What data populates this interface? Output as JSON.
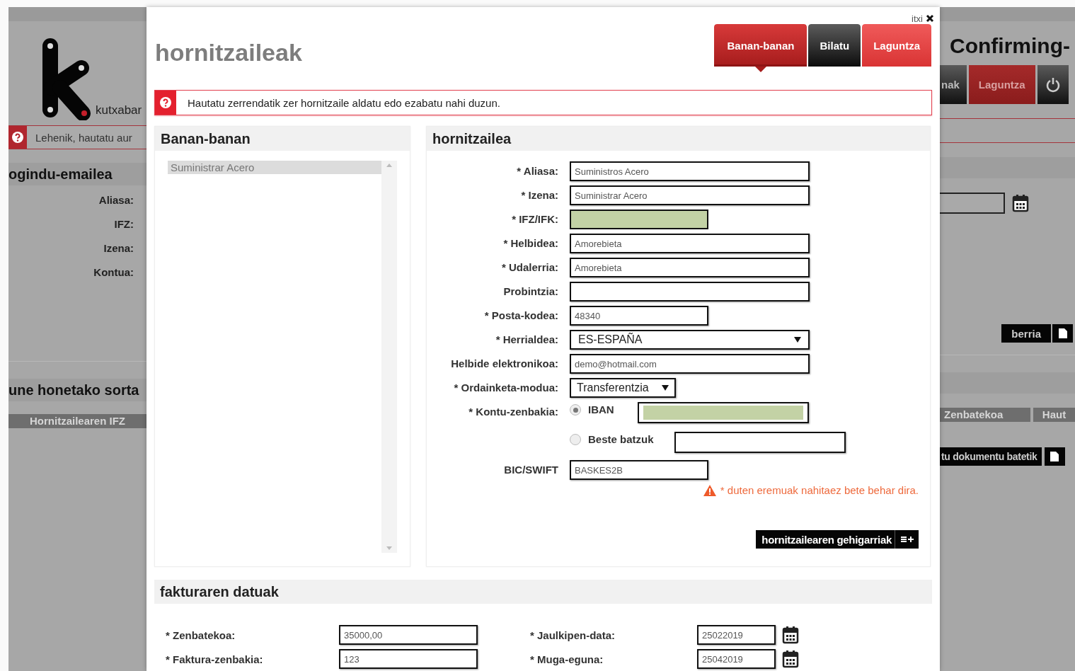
{
  "background_left": {
    "logo_text": "kutxabar",
    "notice": "Lehenik, hautatu aur",
    "section_title": "ogindu-emailea",
    "fields": [
      {
        "label": "Aliasa:"
      },
      {
        "label": "IFZ:"
      },
      {
        "label": "Izena:"
      },
      {
        "label": "Kontua:"
      }
    ],
    "batch_title": "une honetako sorta",
    "column": "Hornitzailearen IFZ"
  },
  "background_right": {
    "title": "Confirming-",
    "tabs": [
      {
        "label": "nak",
        "selected": false
      },
      {
        "label": "Laguntza",
        "selected": true
      }
    ],
    "new_button": "berria",
    "columns": [
      "Zenbatekoa",
      "Haut"
    ],
    "import_button": "tu dokumentu batetik"
  },
  "modal": {
    "close_label": "itxi",
    "title": "hornitzaileak",
    "tabs": [
      {
        "label": "Banan-banan",
        "selected": true,
        "kind": "nav"
      },
      {
        "label": "Bilatu",
        "selected": false,
        "kind": "nav"
      },
      {
        "label": "Laguntza",
        "selected": false,
        "kind": "help"
      }
    ],
    "message": "Hautatu zerrendatik zer hornitzaile aldatu edo ezabatu nahi duzun.",
    "list_panel": {
      "title": "Banan-banan",
      "items": [
        {
          "label": "Suministrar Acero",
          "selected": true
        }
      ]
    },
    "form": {
      "title": "hornitzailea",
      "fields": [
        {
          "label": "* Aliasa:",
          "kind": "text",
          "value": "Suministros Acero"
        },
        {
          "label": "* Izena:",
          "kind": "text",
          "value": "Suministrar Acero"
        },
        {
          "label": "* IFZ/IFK:",
          "kind": "redacted"
        },
        {
          "label": "* Helbidea:",
          "kind": "text",
          "value": "Amorebieta"
        },
        {
          "label": "* Udalerria:",
          "kind": "text",
          "value": "Amorebieta"
        },
        {
          "label": "Probintzia:",
          "kind": "text"
        },
        {
          "label": "* Posta-kodea:",
          "kind": "short",
          "value": "48340"
        },
        {
          "label": "* Herrialdea:",
          "kind": "select",
          "value": "ES-ESPAÑA"
        },
        {
          "label": "Helbide elektronikoa:",
          "kind": "text",
          "value": "demo@hotmail.com"
        },
        {
          "label": "* Ordainketa-modua:",
          "kind": "select-short",
          "value": "Transferentzia"
        },
        {
          "label": "* Kontu-zenbakia:",
          "kind": "radio",
          "options": [
            {
              "label": "IBAN",
              "selected": true,
              "redacted": true
            },
            {
              "label": "Beste batzuk",
              "selected": false,
              "redacted": false
            }
          ]
        },
        {
          "label": "BIC/SWIFT",
          "kind": "short",
          "value": "BASKES2B"
        }
      ],
      "required_note": "* duten eremuak nahitaez bete behar dira.",
      "more_button": "hornitzailearen gehigarriak"
    },
    "invoice": {
      "title": "fakturaren datuak",
      "fields": [
        {
          "label": "* Zenbatekoa:",
          "value": "35000,00",
          "kind": "text"
        },
        {
          "label": "* Jaulkipen-data:",
          "value": "25022019",
          "kind": "date"
        },
        {
          "label": "* Faktura-zenbakia:",
          "value": "123",
          "kind": "text"
        },
        {
          "label": "* Muga-eguna:",
          "value": "25042019",
          "kind": "date"
        }
      ]
    }
  }
}
